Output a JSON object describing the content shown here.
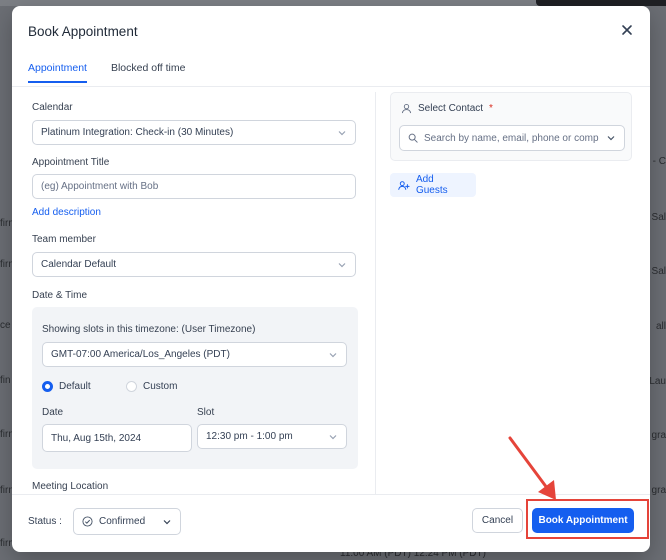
{
  "background": {
    "left_fragments": [
      "firm",
      "firm",
      "ce",
      "fin",
      "firm",
      "firm",
      "firm"
    ],
    "right_fragments": [
      "- C",
      "Sal",
      "Sal",
      "all",
      "Lau",
      "gra",
      "gra"
    ],
    "bottom_times": "11:00 AM (PDT)          12:24 PM (PDT)"
  },
  "modal": {
    "title": "Book Appointment",
    "tabs": [
      {
        "label": "Appointment",
        "active": true
      },
      {
        "label": "Blocked off time",
        "active": false
      }
    ]
  },
  "form": {
    "calendar_label": "Calendar",
    "calendar_value": "Platinum Integration: Check-in (30 Minutes)",
    "title_label": "Appointment Title",
    "title_placeholder": "(eg) Appointment with Bob",
    "add_description": "Add description",
    "team_label": "Team member",
    "team_value": "Calendar Default",
    "datetime_label": "Date & Time",
    "timezone_label": "Showing slots in this timezone: (User Timezone)",
    "timezone_value": "GMT-07:00 America/Los_Angeles (PDT)",
    "radio_default": "Default",
    "radio_custom": "Custom",
    "date_label": "Date",
    "date_value": "Thu, Aug 15th, 2024",
    "slot_label": "Slot",
    "slot_value": "12:30 pm - 1:00 pm",
    "location_label": "Meeting Location"
  },
  "contact": {
    "label": "Select Contact",
    "required_mark": "*",
    "search_placeholder": "Search by name, email, phone or comp",
    "add_guests": "Add Guests"
  },
  "footer": {
    "status_label": "Status :",
    "status_value": "Confirmed",
    "cancel": "Cancel",
    "book": "Book Appointment"
  },
  "colors": {
    "primary": "#155eef",
    "annotation": "#e5443a"
  }
}
